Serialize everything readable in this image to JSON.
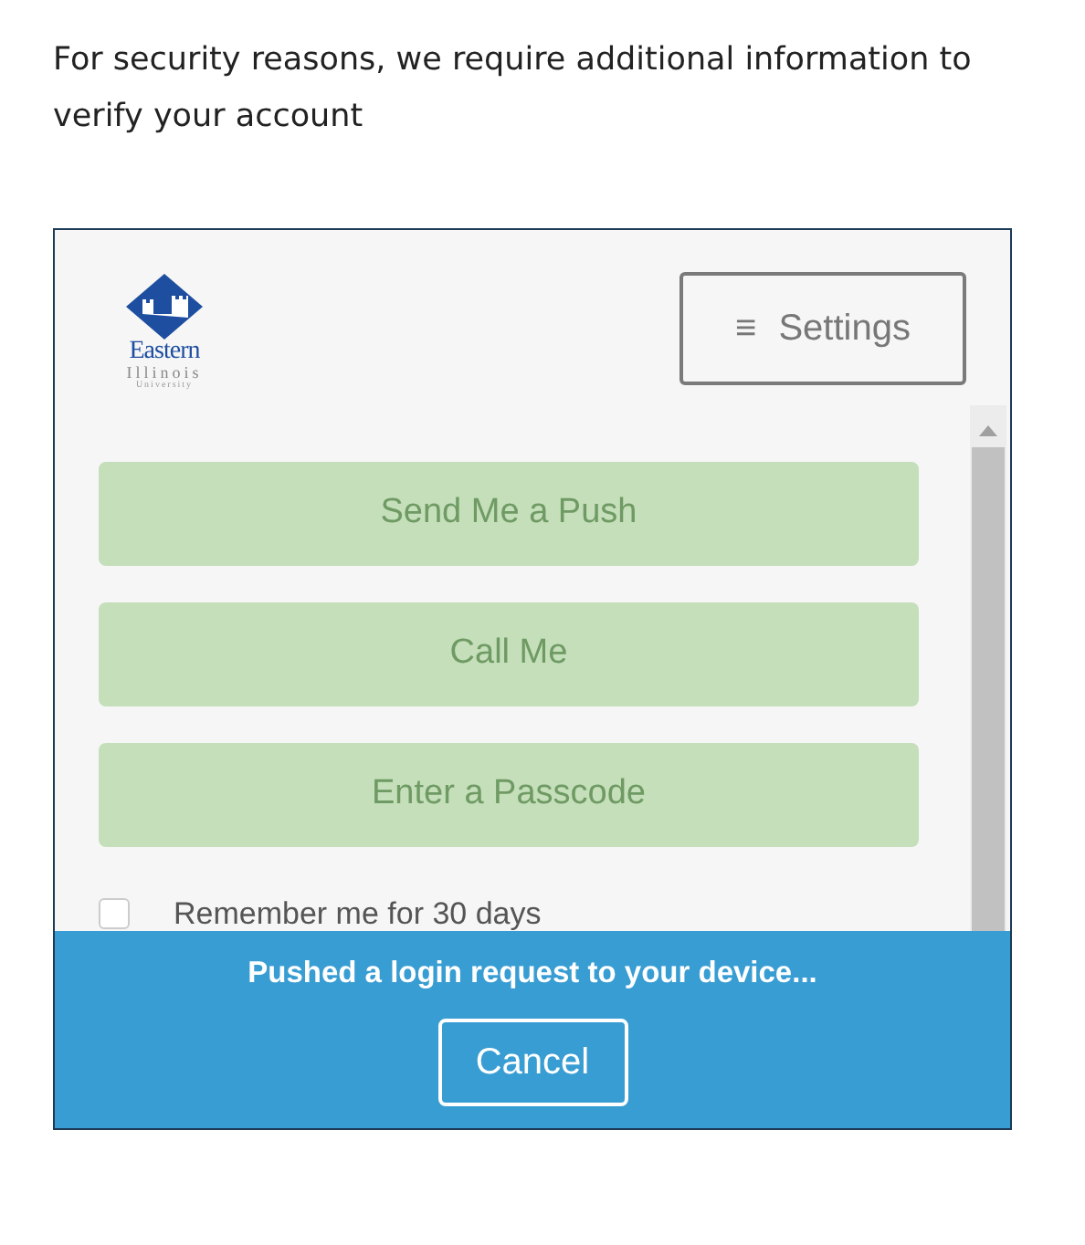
{
  "intro": "For security reasons, we require additional information to verify your account",
  "logo": {
    "name": "Eastern",
    "line2": "Illinois",
    "line3": "University"
  },
  "settings_button": {
    "icon": "≡",
    "label": "Settings"
  },
  "auth_buttons": [
    {
      "label": "Send Me a Push",
      "disabled": true
    },
    {
      "label": "Call Me",
      "disabled": true
    },
    {
      "label": "Enter a Passcode",
      "disabled": true
    }
  ],
  "remember": {
    "label": "Remember me for 30 days",
    "checked": false
  },
  "status_banner": {
    "message": "Pushed a login request to your device...",
    "button": "Cancel"
  }
}
